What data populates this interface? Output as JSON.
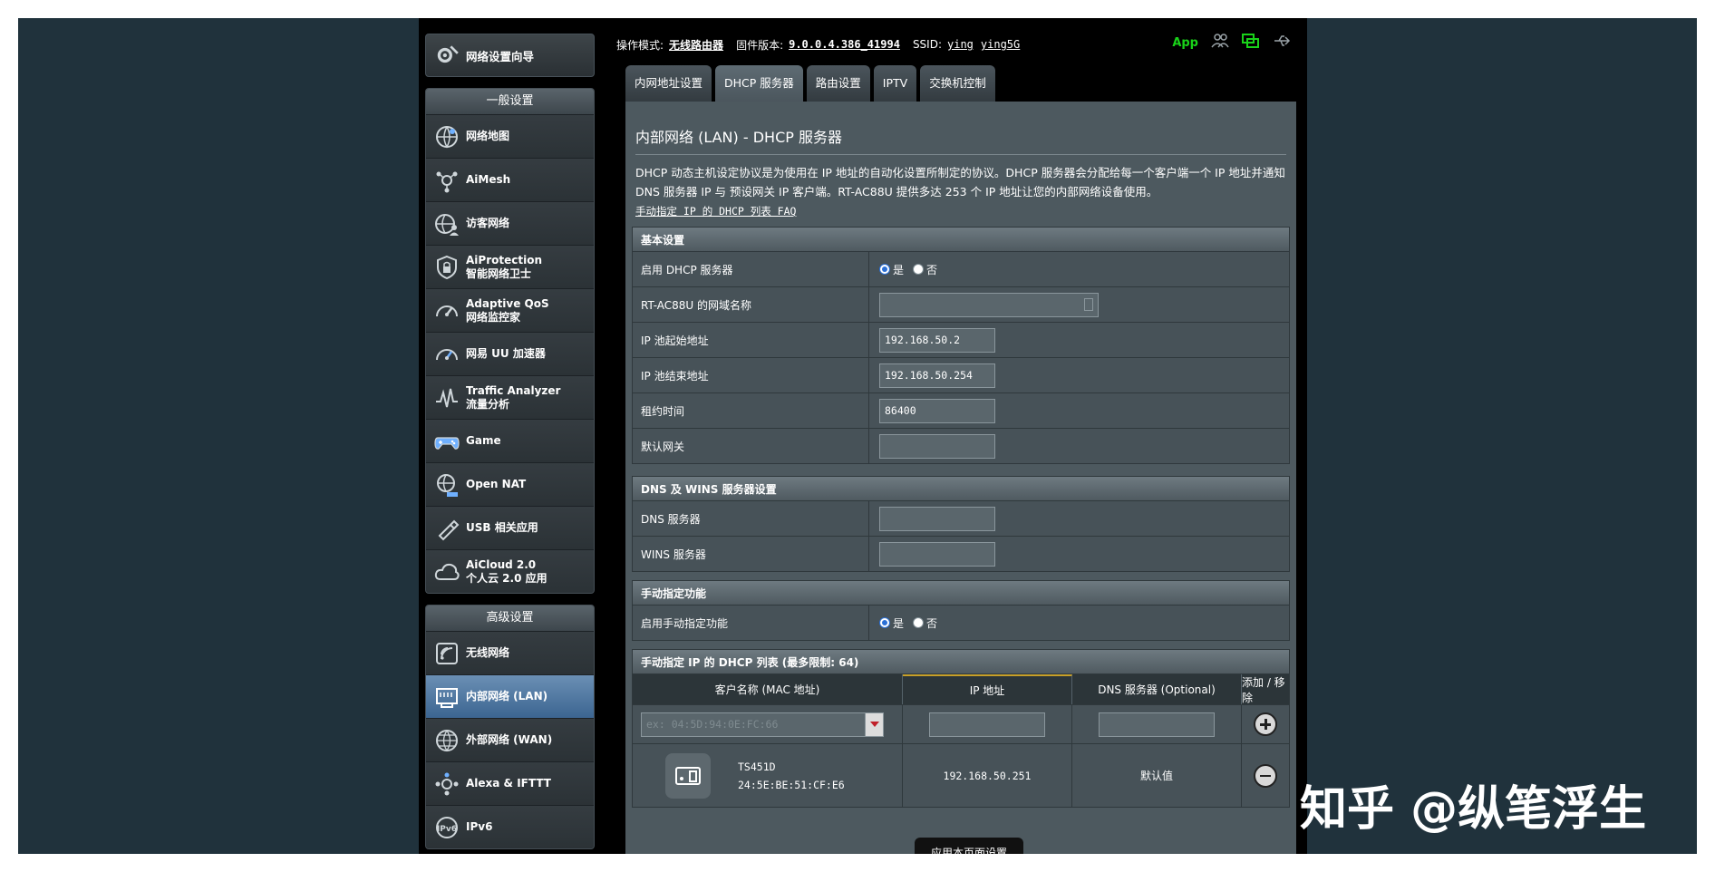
{
  "sidebar": {
    "setup_wizard": "网络设置向导",
    "general_title": "一般设置",
    "general_items": [
      {
        "label": "网络地图",
        "icon": "globe-map-icon"
      },
      {
        "label": "AiMesh",
        "icon": "aimesh-icon"
      },
      {
        "label": "访客网络",
        "icon": "guest-network-icon"
      },
      {
        "label": "AiProtection",
        "sub": "智能网络卫士",
        "icon": "shield-lock-icon"
      },
      {
        "label": "Adaptive QoS",
        "sub": "网络监控家",
        "icon": "speedometer-icon"
      },
      {
        "label": "网易 UU 加速器",
        "icon": "accelerator-icon"
      },
      {
        "label": "Traffic Analyzer",
        "sub": "流量分析",
        "icon": "traffic-icon"
      },
      {
        "label": "Game",
        "icon": "gamepad-icon"
      },
      {
        "label": "Open NAT",
        "icon": "open-nat-icon"
      },
      {
        "label": "USB 相关应用",
        "icon": "usb-icon"
      },
      {
        "label": "AiCloud 2.0",
        "sub": "个人云 2.0 应用",
        "icon": "cloud-icon"
      }
    ],
    "advanced_title": "高级设置",
    "advanced_items": [
      {
        "label": "无线网络",
        "icon": "wireless-icon"
      },
      {
        "label": "内部网络 (LAN)",
        "icon": "lan-icon"
      },
      {
        "label": "外部网络 (WAN)",
        "icon": "wan-globe-icon"
      },
      {
        "label": "Alexa & IFTTT",
        "icon": "alexa-icon"
      },
      {
        "label": "IPv6",
        "icon": "ipv6-icon"
      }
    ]
  },
  "topbar": {
    "mode_label": "操作模式:",
    "mode_value": "无线路由器",
    "firmware_label": "固件版本:",
    "firmware_value": "9.0.0.4.386_41994",
    "ssid_label": "SSID:",
    "ssid_1": "ying",
    "ssid_2": "ying5G",
    "app_label": "App"
  },
  "tabs": [
    "内网地址设置",
    "DHCP 服务器",
    "路由设置",
    "IPTV",
    "交换机控制"
  ],
  "page": {
    "title": "内部网络 (LAN) - DHCP 服务器",
    "description": "DHCP 动态主机设定协议是为使用在 IP 地址的自动化设置所制定的协议。DHCP 服务器会分配给每一个客户端一个 IP 地址并通知 DNS 服务器 IP 与 预设网关 IP 客户端。RT-AC88U 提供多达 253 个 IP 地址让您的内部网络设备使用。",
    "faq_link": "手动指定 IP 的 DHCP 列表 FAQ"
  },
  "basic": {
    "header": "基本设置",
    "enable_dhcp_label": "启用 DHCP 服务器",
    "yes": "是",
    "no": "否",
    "domain_label": "RT-AC88U 的网域名称",
    "domain_value": "",
    "start_label": "IP 池起始地址",
    "start_value": "192.168.50.2",
    "end_label": "IP 池结束地址",
    "end_value": "192.168.50.254",
    "lease_label": "租约时间",
    "lease_value": "86400",
    "gateway_label": "默认网关",
    "gateway_value": ""
  },
  "dns_wins": {
    "header": "DNS 及 WINS 服务器设置",
    "dns_label": "DNS 服务器",
    "dns_value": "",
    "wins_label": "WINS 服务器",
    "wins_value": ""
  },
  "manual": {
    "header": "手动指定功能",
    "enable_label": "启用手动指定功能",
    "yes": "是",
    "no": "否"
  },
  "dhcp_list": {
    "header": "手动指定 IP 的 DHCP 列表 (最多限制: 64)",
    "col_client": "客户名称 (MAC 地址)",
    "col_ip": "IP 地址",
    "col_dns": "DNS 服务器 (Optional)",
    "col_action": "添加 / 移除",
    "mac_placeholder": "ex: 04:5D:94:0E:FC:66",
    "rows": [
      {
        "name": "TS451D",
        "mac": "24:5E:BE:51:CF:E6",
        "ip": "192.168.50.251",
        "dns": "默认值"
      }
    ]
  },
  "apply_button": "应用本页面设置",
  "watermark": "知乎 @纵笔浮生"
}
